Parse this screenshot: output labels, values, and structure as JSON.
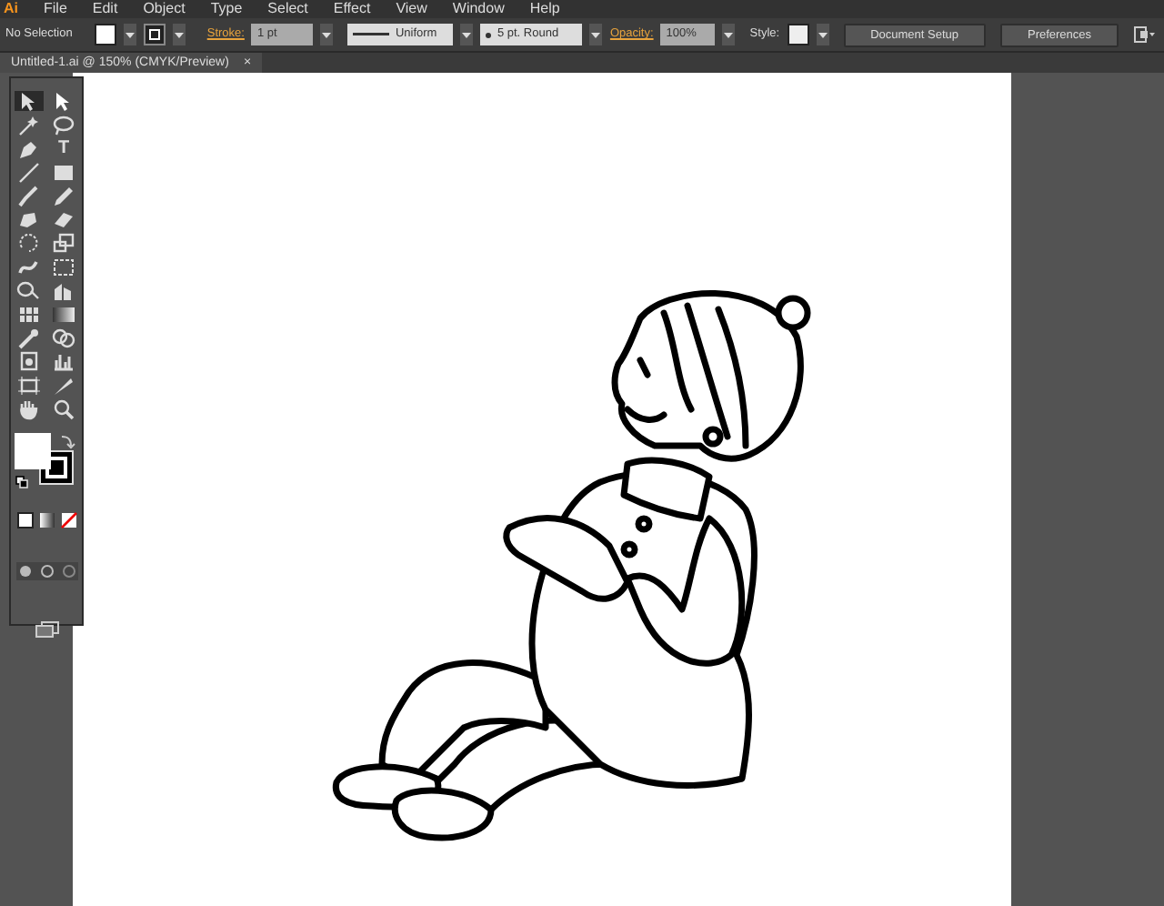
{
  "menu_bar": {
    "logo": "Ai",
    "items": [
      "File",
      "Edit",
      "Object",
      "Type",
      "Select",
      "Effect",
      "View",
      "Window",
      "Help"
    ]
  },
  "control_bar": {
    "selection_label": "No Selection",
    "stroke_label": "Stroke:",
    "stroke_weight": "1 pt",
    "stroke_profile": "Uniform",
    "brush": "5 pt. Round",
    "opacity_label": "Opacity:",
    "opacity": "100%",
    "style_label": "Style:",
    "buttons": [
      "Document Setup",
      "Preferences"
    ]
  },
  "document_tab": {
    "title": "Untitled-1.ai @ 150% (CMYK/Preview)",
    "close": "×"
  },
  "tools": [
    {
      "kind": "selection",
      "selected": true
    },
    {
      "kind": "direct",
      "selected": false
    },
    {
      "kind": "wand",
      "selected": false
    },
    {
      "kind": "lasso",
      "selected": false
    },
    {
      "kind": "pen",
      "selected": false
    },
    {
      "kind": "type",
      "glyph": "T",
      "selected": false
    },
    {
      "kind": "line",
      "selected": false
    },
    {
      "kind": "rect",
      "selected": false
    },
    {
      "kind": "brush",
      "selected": false
    },
    {
      "kind": "pencil",
      "selected": false
    },
    {
      "kind": "blob",
      "selected": false
    },
    {
      "kind": "eraser",
      "selected": false
    },
    {
      "kind": "rotate",
      "selected": false
    },
    {
      "kind": "scale",
      "selected": false
    },
    {
      "kind": "warp",
      "selected": false
    },
    {
      "kind": "transform",
      "selected": false
    },
    {
      "kind": "shapebuilder",
      "selected": false
    },
    {
      "kind": "perspective",
      "selected": false
    },
    {
      "kind": "mesh",
      "selected": false
    },
    {
      "kind": "gradient",
      "selected": false
    },
    {
      "kind": "eyedropper",
      "selected": false
    },
    {
      "kind": "blend",
      "selected": false
    },
    {
      "kind": "spray",
      "selected": false
    },
    {
      "kind": "graph",
      "selected": false
    },
    {
      "kind": "artboard",
      "selected": false
    },
    {
      "kind": "slice",
      "selected": false
    },
    {
      "kind": "hand",
      "selected": false
    },
    {
      "kind": "zoom",
      "selected": false
    }
  ]
}
